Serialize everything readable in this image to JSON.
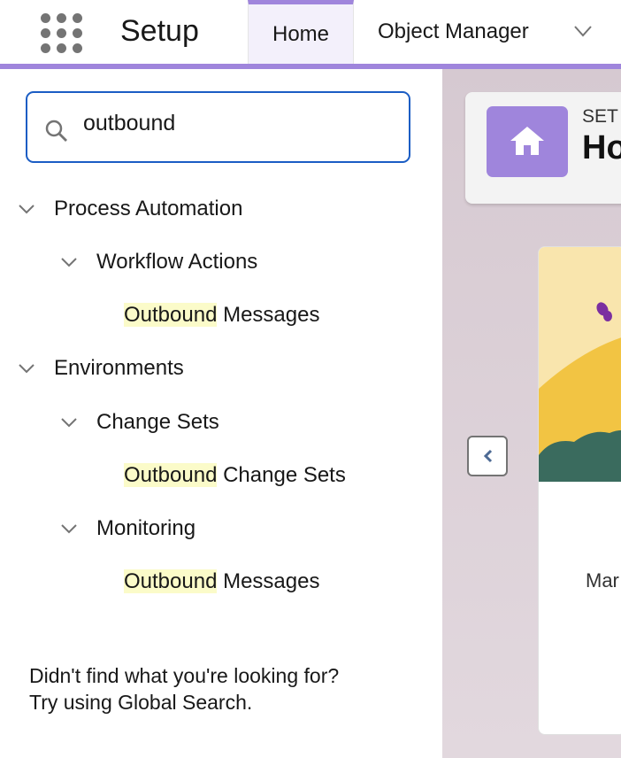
{
  "header": {
    "app_title": "Setup",
    "tabs": [
      {
        "label": "Home",
        "active": true
      },
      {
        "label": "Object Manager"
      }
    ],
    "accent": "#9f85dc"
  },
  "sidebar": {
    "search": {
      "value": "outbound",
      "placeholder": ""
    },
    "tree": [
      {
        "label": "Process Automation",
        "children": [
          {
            "label": "Workflow Actions",
            "children": [
              {
                "highlight": "Outbound",
                "rest": " Messages"
              }
            ]
          }
        ]
      },
      {
        "label": "Environments",
        "children": [
          {
            "label": "Change Sets",
            "children": [
              {
                "highlight": "Outbound",
                "rest": " Change Sets"
              }
            ]
          },
          {
            "label": "Monitoring",
            "children": [
              {
                "highlight": "Outbound",
                "rest": " Messages"
              }
            ]
          }
        ]
      }
    ],
    "footer_line1": "Didn't find what you're looking for?",
    "footer_line2": "Try using Global Search."
  },
  "main": {
    "kicker": "SET",
    "title": "Ho",
    "card_text": "Mar"
  }
}
